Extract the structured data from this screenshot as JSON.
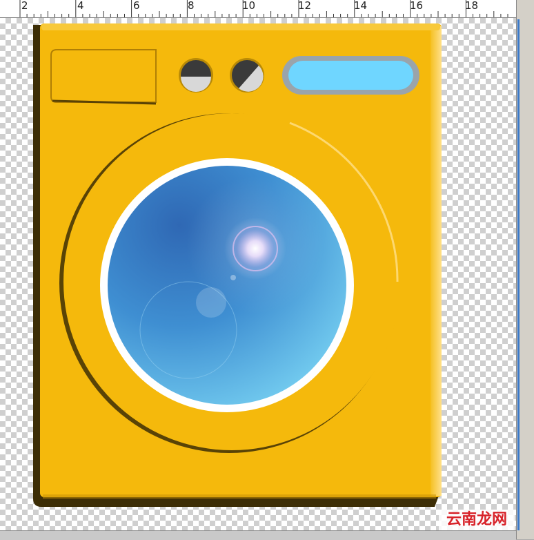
{
  "ruler": {
    "labels": [
      "2",
      "4",
      "6",
      "8",
      "10",
      "12",
      "14",
      "16",
      "18"
    ]
  },
  "washing_machine": {
    "colors": {
      "body": "#f5b90c",
      "body_shadow": "#3d2e06",
      "side_highlight": "#ffd764",
      "display": "#6fd6ff",
      "display_frame": "#9aa4ab",
      "knob_dark": "#3a3a3a",
      "knob_light": "#d8d8d8",
      "glass_dark": "#2a63b0",
      "glass_light": "#6fc7ee",
      "door_ring": "#ffffff"
    }
  },
  "watermark": {
    "text": "云南龙网"
  }
}
